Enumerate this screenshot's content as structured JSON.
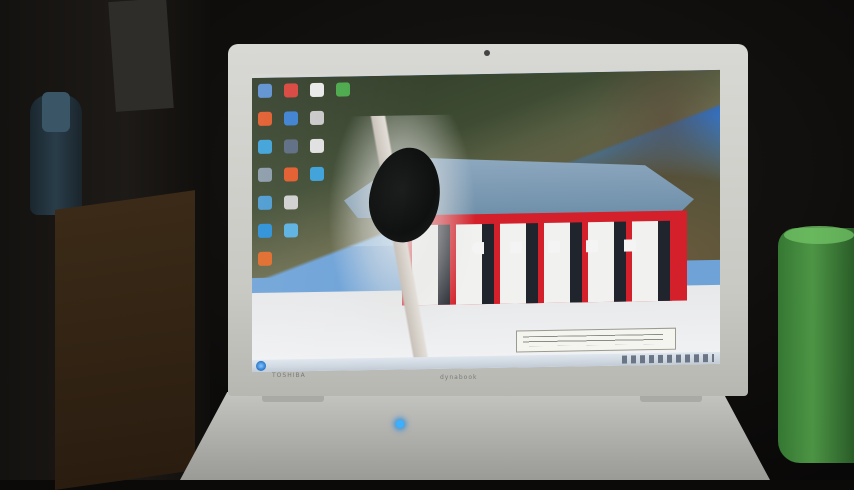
{
  "scene": {
    "colors": {
      "room": "#0d0c0b",
      "laptop_body": "#d1d1cc",
      "sky": "#2f74d0",
      "temple_red": "#d4202a",
      "snow": "#eeeff1",
      "cup_green": "#4f9c48",
      "power_led": "#3ab0ff"
    },
    "laptop": {
      "brand": "TOSHIBA",
      "model": "dynabook"
    },
    "desktop_icons": [
      {
        "color": "#5a8fd0"
      },
      {
        "color": "#d8423a"
      },
      {
        "color": "#e8e8e8"
      },
      {
        "color": "#4aa84a"
      },
      {
        "color": "#e05a2a"
      },
      {
        "color": "#3a7fd0"
      },
      {
        "color": "#c8c8c8"
      },
      {
        "color": "#3ca0d8"
      },
      {
        "color": "#5a6a80"
      },
      {
        "color": "#e0e0e0"
      },
      {
        "color": "#8a9aa8"
      },
      {
        "color": "#e25a2a"
      },
      {
        "color": "#3aa0d8"
      },
      {
        "color": "#4a9ad0"
      },
      {
        "color": "#d0d0d0"
      },
      {
        "color": "#2a8fd8"
      },
      {
        "color": "#5ab0e0"
      },
      {
        "color": "#e06a2a"
      }
    ]
  }
}
